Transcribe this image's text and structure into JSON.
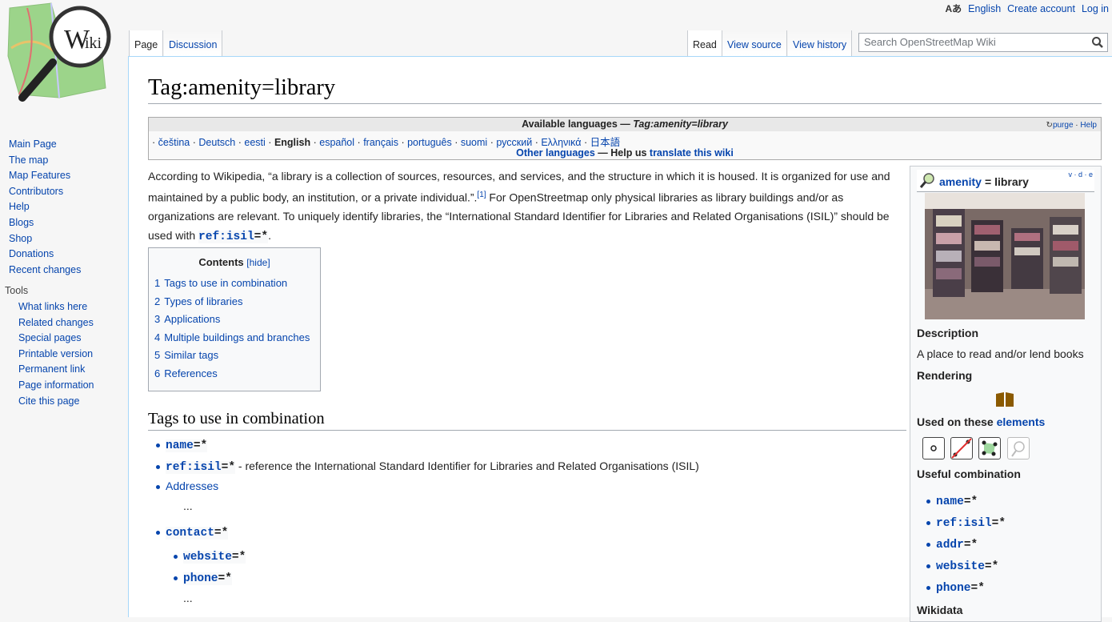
{
  "logo": {
    "text_main": "W",
    "text_sub": "iki"
  },
  "personal": {
    "lang_icon": "Aあ",
    "lang": "English",
    "create": "Create account",
    "login": "Log in"
  },
  "nav": {
    "main": [
      "Main Page",
      "The map",
      "Map Features",
      "Contributors",
      "Help",
      "Blogs",
      "Shop",
      "Donations",
      "Recent changes"
    ],
    "tools_heading": "Tools",
    "tools": [
      "What links here",
      "Related changes",
      "Special pages",
      "Printable version",
      "Permanent link",
      "Page information",
      "Cite this page"
    ]
  },
  "tabs": {
    "page": "Page",
    "discussion": "Discussion",
    "read": "Read",
    "view_source": "View source",
    "view_history": "View history"
  },
  "search": {
    "placeholder": "Search OpenStreetMap Wiki"
  },
  "title": "Tag:amenity=library",
  "langbox": {
    "header": "Available languages —",
    "header_italic": "Tag:amenity=library",
    "purge": "purge",
    "help": "Help",
    "sep": "·",
    "languages": [
      "čeština",
      "Deutsch",
      "eesti",
      "English",
      "español",
      "français",
      "português",
      "suomi",
      "русский",
      "Ελληνικά",
      "日本語"
    ],
    "other": "Other languages",
    "help_us": "— Help us",
    "translate": "translate this wiki"
  },
  "intro": {
    "p1": "According to Wikipedia, “a library is a collection of sources, resources, and services, and the structure in which it is housed. It is organized for use and maintained by a public body, an institution, or a private individual.”.",
    "ref": "[1]",
    "p2": " For OpenStreetmap only physical libraries as library buildings and/or as organizations are relevant. To uniquely identify libraries, the “International Standard Identifier for Libraries and Related Organisations (ISIL)” should be used with ",
    "code": "ref:isil",
    "code_tail": "=*",
    "end": "."
  },
  "toc": {
    "title": "Contents",
    "hide": "[hide]",
    "items": [
      {
        "n": "1",
        "label": "Tags to use in combination"
      },
      {
        "n": "2",
        "label": "Types of libraries"
      },
      {
        "n": "3",
        "label": "Applications"
      },
      {
        "n": "4",
        "label": "Multiple buildings and branches"
      },
      {
        "n": "5",
        "label": "Similar tags"
      },
      {
        "n": "6",
        "label": "References"
      }
    ]
  },
  "section": {
    "heading": "Tags to use in combination",
    "name_key": "name",
    "name_val": "=*",
    "isil_key": "ref:isil",
    "isil_val": "=*",
    "isil_desc": " - reference the International Standard Identifier for Libraries and Related Organisations (ISIL)",
    "addresses": "Addresses",
    "ellipsis": "...",
    "contact_key": "contact",
    "contact_val": "=*",
    "website_key": "website",
    "website_val": "=*",
    "phone_key": "phone",
    "phone_val": "=*",
    "ellipsis2": "..."
  },
  "infobox": {
    "vde": "v · d · e",
    "key": "amenity",
    "eq": " = library",
    "description_label": "Description",
    "description": "A place to read and/or lend books",
    "rendering_label": "Rendering",
    "used_on": "Used on these",
    "elements": "elements",
    "useful_label": "Useful combination",
    "combos": [
      {
        "k": "name",
        "v": "=*"
      },
      {
        "k": "ref:isil",
        "v": "=*"
      },
      {
        "k": "addr",
        "v": "=*"
      },
      {
        "k": "website",
        "v": "=*"
      },
      {
        "k": "phone",
        "v": "=*"
      }
    ],
    "wikidata_label": "Wikidata"
  },
  "colors": {
    "link": "#0645ad",
    "border": "#a2a9b1",
    "rendering_icon": "#8b5a00"
  }
}
